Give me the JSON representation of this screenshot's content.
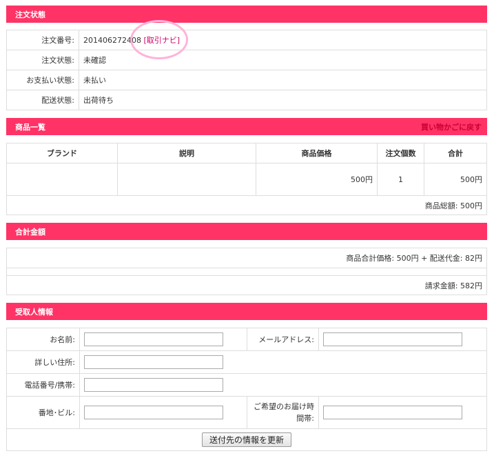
{
  "order_status": {
    "header": "注文状態",
    "rows": [
      {
        "label": "注文番号:",
        "value": "201406272408"
      },
      {
        "label": "注文状態:",
        "value": "未確認"
      },
      {
        "label": "お支払い状態:",
        "value": "未払い"
      },
      {
        "label": "配送状態:",
        "value": "出荷待ち"
      }
    ],
    "trade_navi_link": "[取引ナビ]"
  },
  "products": {
    "header": "商品一覧",
    "back_to_cart": "買い物かごに戻す",
    "columns": [
      "ブランド",
      "説明",
      "商品価格",
      "注文個数",
      "合計"
    ],
    "rows": [
      {
        "brand": "",
        "description": "",
        "price": "500円",
        "quantity": "1",
        "total": "500円"
      }
    ],
    "subtotal": "商品総額: 500円"
  },
  "total": {
    "header": "合計金額",
    "breakdown": "商品合計価格: 500円 + 配送代金: 82円",
    "billing": "請求金額: 582円"
  },
  "recipient": {
    "header": "受取人情報",
    "name_label": "お名前:",
    "email_label": "メールアドレス:",
    "address_label": "詳しい住所:",
    "phone_label": "電話番号/携帯:",
    "building_label": "番地･ビル:",
    "delivery_time_label": "ご希望のお届け時間帯:",
    "name_value": "",
    "email_value": "",
    "address_value": "",
    "phone_value": "",
    "building_value": "",
    "delivery_time_value": "",
    "update_button": "送付先の情報を更新"
  },
  "colors": {
    "header_bg": "#ff3366",
    "link": "#cc0066",
    "highlight_circle": "#ffb3d9"
  }
}
